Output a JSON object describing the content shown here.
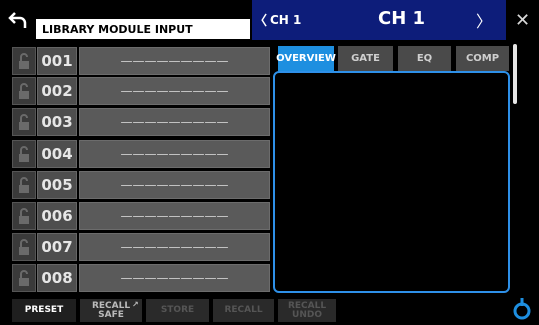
{
  "header": {
    "title": "LIBRARY MODULE INPUT",
    "channel_small": "CH 1",
    "channel_big": "CH 1",
    "prev_glyph": "〈",
    "next_glyph": "〉",
    "close_glyph": "✕"
  },
  "library": {
    "rows": [
      {
        "number": "001",
        "name": "—————————"
      },
      {
        "number": "002",
        "name": "—————————"
      },
      {
        "number": "003",
        "name": "—————————"
      },
      {
        "number": "004",
        "name": "—————————"
      },
      {
        "number": "005",
        "name": "—————————"
      },
      {
        "number": "006",
        "name": "—————————"
      },
      {
        "number": "007",
        "name": "—————————"
      },
      {
        "number": "008",
        "name": "—————————"
      }
    ]
  },
  "tabs": [
    {
      "label": "OVERVIEW",
      "active": true
    },
    {
      "label": "GATE",
      "active": false
    },
    {
      "label": "EQ",
      "active": false
    },
    {
      "label": "COMP",
      "active": false
    }
  ],
  "bottom": {
    "preset": "PRESET",
    "recall_safe_line1": "RECALL",
    "recall_safe_line2": "SAFE",
    "store": "STORE",
    "recall": "RECALL",
    "recall_undo_line1": "RECALL",
    "recall_undo_line2": "UNDO"
  },
  "colors": {
    "accent": "#1e8fe0",
    "channel_bar": "#0d1d7a"
  },
  "icons": {
    "back": "back-arrow-icon",
    "lock": "unlock-icon",
    "knob": "knob-icon"
  }
}
